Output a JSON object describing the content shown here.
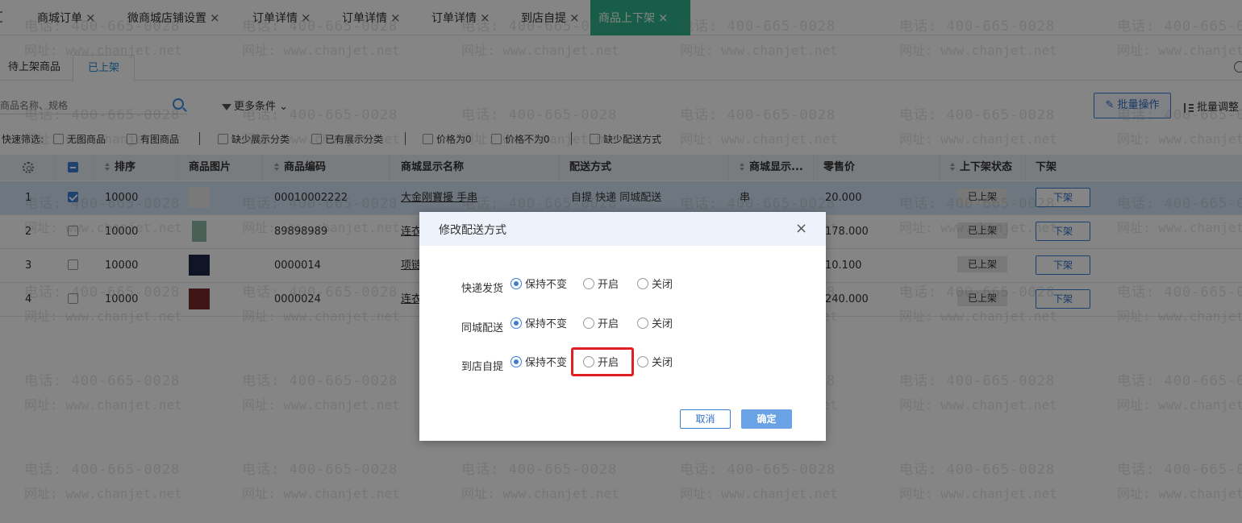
{
  "top_tabs": [
    {
      "label": "商城订单"
    },
    {
      "label": "微商城店铺设置"
    },
    {
      "label": "订单详情"
    },
    {
      "label": "订单详情"
    },
    {
      "label": "订单详情"
    },
    {
      "label": "到店自提"
    },
    {
      "label": "商品上下架"
    }
  ],
  "close_glyph": "×",
  "sub_tabs": [
    {
      "label": "待上架商品"
    },
    {
      "label": "已上架"
    }
  ],
  "search": {
    "placeholder": "商品名称、规格"
  },
  "more_filters_label": "更多条件",
  "batch_operation_label": "批量操作",
  "batch_adjust_label": "批量调整",
  "quick_filter": {
    "label": "快速筛选:",
    "options": [
      "无图商品",
      "有图商品",
      "缺少展示分类",
      "已有展示分类",
      "价格为0",
      "价格不为0",
      "缺少配送方式"
    ]
  },
  "table": {
    "headers": [
      "排序",
      "商品图片",
      "商品编码",
      "商城显示名称",
      "配送方式",
      "商城显示...",
      "零售价",
      "上下架状态",
      "下架"
    ],
    "rows": [
      {
        "index": "1",
        "sort": "10000",
        "code": "00010002222",
        "name": "大金刚寶擾 手串",
        "delivery": "自提 快递 同城配送",
        "unit": "串",
        "price": "20.000",
        "status": "已上架",
        "action": "下架",
        "checked": true,
        "thumb_color": "#e8e8e8"
      },
      {
        "index": "2",
        "sort": "10000",
        "code": "89898989",
        "name": "连衣",
        "delivery": "",
        "unit": "",
        "price": "178.000",
        "status": "已上架",
        "action": "下架",
        "checked": false,
        "thumb_color": "#8fb6a6"
      },
      {
        "index": "3",
        "sort": "10000",
        "code": "0000014",
        "name": "项链",
        "delivery": "",
        "unit": "",
        "price": "10.100",
        "status": "已上架",
        "action": "下架",
        "checked": false,
        "thumb_color": "#1f2a4a"
      },
      {
        "index": "4",
        "sort": "10000",
        "code": "0000024",
        "name": "连衣",
        "delivery": "",
        "unit": "",
        "price": "240.000",
        "status": "已上架",
        "action": "下架",
        "checked": false,
        "thumb_color": "#7a2a2a"
      }
    ]
  },
  "watermark": {
    "line1": "电话: 400-665-0028",
    "line2": "网址: www.chanjet.net"
  },
  "modal": {
    "title": "修改配送方式",
    "close_glyph": "×",
    "rows": [
      {
        "label": "快递发货",
        "options": [
          "保持不变",
          "开启",
          "关闭"
        ],
        "selected": 0
      },
      {
        "label": "同城配送",
        "options": [
          "保持不变",
          "开启",
          "关闭"
        ],
        "selected": 0
      },
      {
        "label": "到店自提",
        "options": [
          "保持不变",
          "开启",
          "关闭"
        ],
        "selected": 0
      }
    ],
    "cancel_label": "取消",
    "confirm_label": "确定"
  },
  "colors": {
    "active_tab": "#2db38a",
    "accent_blue": "#3a7fd5",
    "highlight_red": "#e02020"
  }
}
